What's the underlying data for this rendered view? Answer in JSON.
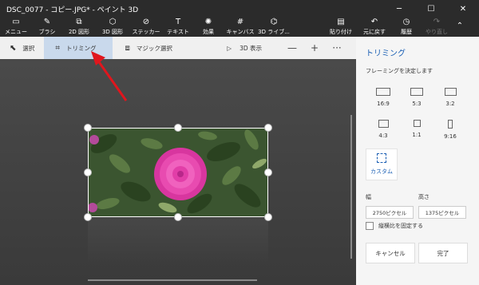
{
  "window": {
    "title": "DSC_0077 - コピー.JPG* - ペイント 3D"
  },
  "toolbar": {
    "items": [
      {
        "label": "メニュー",
        "icon": "folder-icon"
      },
      {
        "label": "ブラシ",
        "icon": "brush-icon"
      },
      {
        "label": "2D 図形",
        "icon": "2d-shapes-icon"
      },
      {
        "label": "3D 図形",
        "icon": "3d-shapes-icon"
      },
      {
        "label": "ステッカー",
        "icon": "sticker-icon"
      },
      {
        "label": "テキスト",
        "icon": "text-icon"
      },
      {
        "label": "効果",
        "icon": "effects-icon"
      },
      {
        "label": "キャンバス",
        "icon": "canvas-icon"
      },
      {
        "label": "3D ライブ...",
        "icon": "3d-library-icon"
      }
    ],
    "right_items": [
      {
        "label": "貼り付け",
        "icon": "paste-icon"
      },
      {
        "label": "元に戻す",
        "icon": "undo-icon"
      },
      {
        "label": "履歴",
        "icon": "history-icon"
      },
      {
        "label": "やり直し",
        "icon": "redo-icon"
      }
    ]
  },
  "subbar": {
    "select_label": "選択",
    "crop_label": "トリミング",
    "magic_select_label": "マジック選択",
    "view3d_label": "3D 表示",
    "zoom_out": "—",
    "zoom_in": "+",
    "more": "···"
  },
  "panel": {
    "title": "トリミング",
    "subtitle": "フレーミングを決定します",
    "ratios": [
      "16:9",
      "5:3",
      "3:2",
      "4:3",
      "1:1",
      "9:16"
    ],
    "custom_label": "カスタム",
    "width_label": "幅",
    "height_label": "高さ",
    "width_value": "2750ピクセル",
    "height_value": "1375ピクセル",
    "lock_aspect_label": "縦横比を固定する",
    "cancel_label": "キャンセル",
    "done_label": "完了"
  },
  "colors": {
    "accent": "#1a5fb4",
    "annotation_arrow": "#e0161d",
    "flower": "#e83aa8"
  }
}
